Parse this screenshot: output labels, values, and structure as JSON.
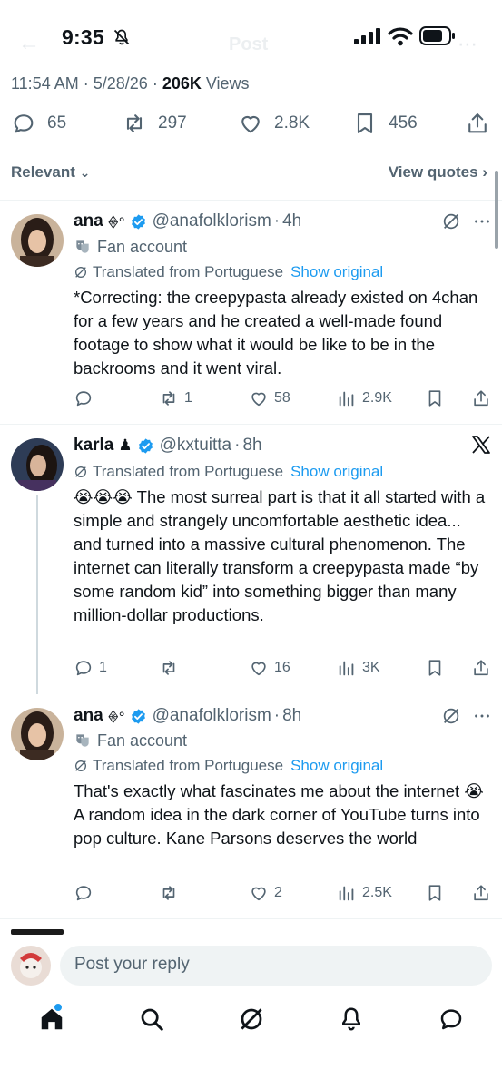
{
  "status_bar": {
    "time": "9:35",
    "header_title": "Post"
  },
  "post_meta": {
    "time": "11:54 AM",
    "date": "5/28/26",
    "views_count": "206K",
    "views_label": "Views"
  },
  "post_stats": {
    "replies": "65",
    "reposts": "297",
    "likes": "2.8K",
    "bookmarks": "456"
  },
  "filters": {
    "sort_label": "Relevant",
    "quotes_label": "View quotes"
  },
  "replies": [
    {
      "display_name": "ana",
      "name_emoji": "𖢻°",
      "handle": "@anafolklorism",
      "time": "4h",
      "label": "Fan account",
      "translated_label": "Translated from Portuguese",
      "show_original": "Show original",
      "text": "*Correcting: the creepypasta already existed on 4chan for a few years and he created a well-made found footage to show what it would be like to be in the backrooms and it went viral.",
      "stats": {
        "replies": "",
        "reposts": "1",
        "likes": "58",
        "views": "2.9K"
      }
    },
    {
      "display_name": "karla",
      "name_emoji": "♟",
      "handle": "@kxtuitta",
      "time": "8h",
      "translated_label": "Translated from Portuguese",
      "show_original": "Show original",
      "text": "😭😭😭 The most surreal part is that it all started with a simple and strangely uncomfortable aesthetic idea... and turned into a massive cultural phenomenon. The internet can literally transform a creepypasta made “by some random kid” into something bigger than many million-dollar productions.",
      "stats": {
        "replies": "1",
        "reposts": "",
        "likes": "16",
        "views": "3K"
      }
    },
    {
      "display_name": "ana",
      "name_emoji": "𖢻°",
      "handle": "@anafolklorism",
      "time": "8h",
      "label": "Fan account",
      "translated_label": "Translated from Portuguese",
      "show_original": "Show original",
      "text": "That's exactly what fascinates me about the internet 😭 A random idea in the dark corner of YouTube turns into pop culture. Kane Parsons deserves the world",
      "stats": {
        "replies": "",
        "reposts": "",
        "likes": "2",
        "views": "2.5K"
      }
    }
  ],
  "composer": {
    "placeholder": "Post your reply"
  },
  "colors": {
    "accent": "#1d9bf0",
    "text_primary": "#0f1419",
    "text_secondary": "#536471",
    "divider": "#eff3f4"
  },
  "icons": [
    "reply-icon",
    "repost-icon",
    "like-icon",
    "bookmark-icon",
    "share-icon",
    "views-icon",
    "grok-icon",
    "more-icon",
    "x-logo-icon",
    "home-icon",
    "search-icon",
    "notifications-icon",
    "messages-icon"
  ]
}
